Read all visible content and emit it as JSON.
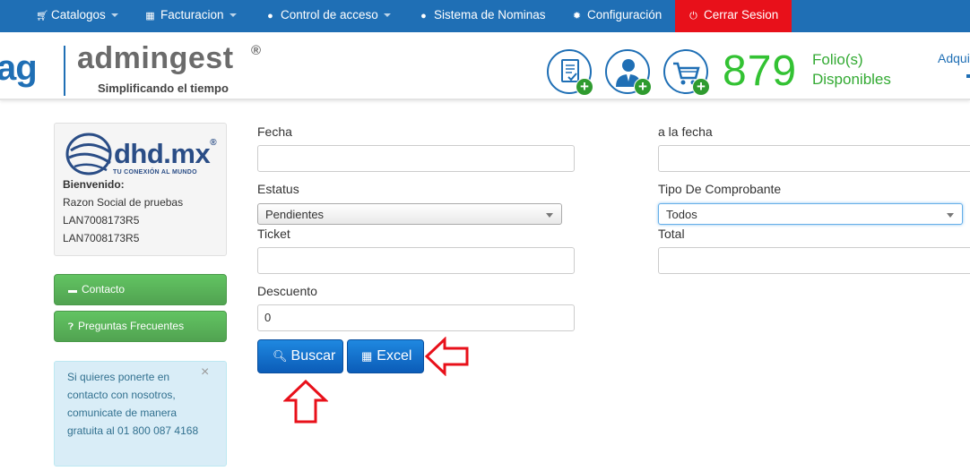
{
  "navbar": {
    "items": [
      {
        "label": "Catalogos",
        "icon": "cart-icon",
        "dropdown": true
      },
      {
        "label": "Facturacion",
        "icon": "grid-icon",
        "dropdown": true
      },
      {
        "label": "Control de acceso",
        "icon": "user-icon",
        "dropdown": true
      },
      {
        "label": "Sistema de Nominas",
        "icon": "user-icon",
        "dropdown": false
      },
      {
        "label": "Configuración",
        "icon": "gear-icon",
        "dropdown": false
      }
    ],
    "logout_label": "Cerrar Sesion",
    "bg_color": "#1f6fb5",
    "logout_color": "#e8101a"
  },
  "header": {
    "logo_short": "ag",
    "logo_name": "admingest",
    "logo_reg": "®",
    "tagline": "Simplificando el tiempo",
    "folio_count": "879",
    "folio_label_1": "Folio(s)",
    "folio_label_2": "Disponibles",
    "adquirir": "Adquirir"
  },
  "sidebar": {
    "company_logo": "dhd.mx",
    "company_logo_reg": "®",
    "company_slogan": "TU CONEXIÓN AL MUNDO",
    "welcome": "Bienvenido:",
    "razon_social": "Razon Social de pruebas",
    "rfc_1": "LAN7008173R5",
    "rfc_2": "LAN7008173R5",
    "contacto_label": "Contacto",
    "preguntas_label": "Preguntas Frecuentes",
    "info_text": "Si quieres ponerte en contacto con nosotros, comunicate de manera gratuita al 01 800 087 4168",
    "info_close": "×"
  },
  "form": {
    "fecha_label": "Fecha",
    "fecha_value": "",
    "a_la_fecha_label": "a la fecha",
    "a_la_fecha_value": "",
    "estatus_label": "Estatus",
    "estatus_value": "Pendientes",
    "tipo_label": "Tipo De Comprobante",
    "tipo_value": "Todos",
    "ticket_label": "Ticket",
    "ticket_value": "",
    "total_label": "Total",
    "total_value": "",
    "descuento_label": "Descuento",
    "descuento_value": "0",
    "buscar_label": "Buscar",
    "excel_label": "Excel"
  },
  "colors": {
    "accent": "#1f6fb5",
    "success": "#51a351",
    "folio_green": "#33c233",
    "annotation_red": "#e8101a"
  }
}
